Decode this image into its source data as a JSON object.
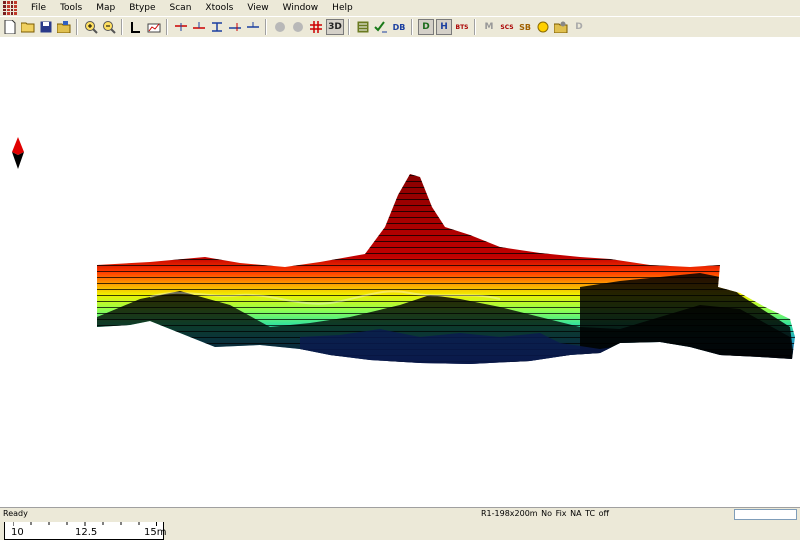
{
  "menu": {
    "items": [
      "File",
      "Tools",
      "Map",
      "Btype",
      "Scan",
      "Xtools",
      "View",
      "Window",
      "Help"
    ]
  },
  "toolbar": {
    "buttons": [
      {
        "icon": "new-file-icon"
      },
      {
        "icon": "open-folder-icon"
      },
      {
        "icon": "save-icon"
      },
      {
        "icon": "export-icon"
      },
      {
        "icon": "zoom-in-icon"
      },
      {
        "icon": "zoom-out-icon"
      },
      {
        "icon": "profile-l-icon"
      },
      {
        "icon": "chart-icon"
      },
      {
        "icon": "marker-1-icon"
      },
      {
        "icon": "marker-2-icon"
      },
      {
        "icon": "marker-3-icon"
      },
      {
        "icon": "marker-4-icon"
      },
      {
        "icon": "marker-5-icon"
      },
      {
        "icon": "gray-disc-1-icon"
      },
      {
        "icon": "gray-disc-2-icon"
      },
      {
        "icon": "grid-icon"
      },
      {
        "icon": "list-icon"
      },
      {
        "icon": "check-list-icon"
      },
      {
        "icon": "db-icon"
      },
      {
        "icon": "d-view-icon"
      },
      {
        "icon": "h-view-icon"
      },
      {
        "icon": "bts-icon"
      },
      {
        "icon": "m-icon"
      },
      {
        "icon": "scs-icon"
      },
      {
        "icon": "sb-icon"
      },
      {
        "icon": "circle-icon"
      },
      {
        "icon": "settings-icon"
      },
      {
        "icon": "d-icon"
      }
    ],
    "label_3d": "3D",
    "label_bts": "BTS",
    "label_scs": "SCS",
    "label_sb": "SB",
    "label_m": "M",
    "label_d": "D",
    "label_h": "H",
    "label_db": "DB"
  },
  "legend": {
    "min_label": "10",
    "mid_label": "12.5",
    "max_label": "15m",
    "colors": [
      "#b30000",
      "#ff2a00",
      "#ffa600",
      "#ffff00",
      "#80ff40",
      "#00e0a0",
      "#00b8ff",
      "#2040ff",
      "#0a0a80"
    ]
  },
  "status": {
    "ready": "Ready",
    "info": "R1-198x200m No Fix   NA  TC off"
  }
}
